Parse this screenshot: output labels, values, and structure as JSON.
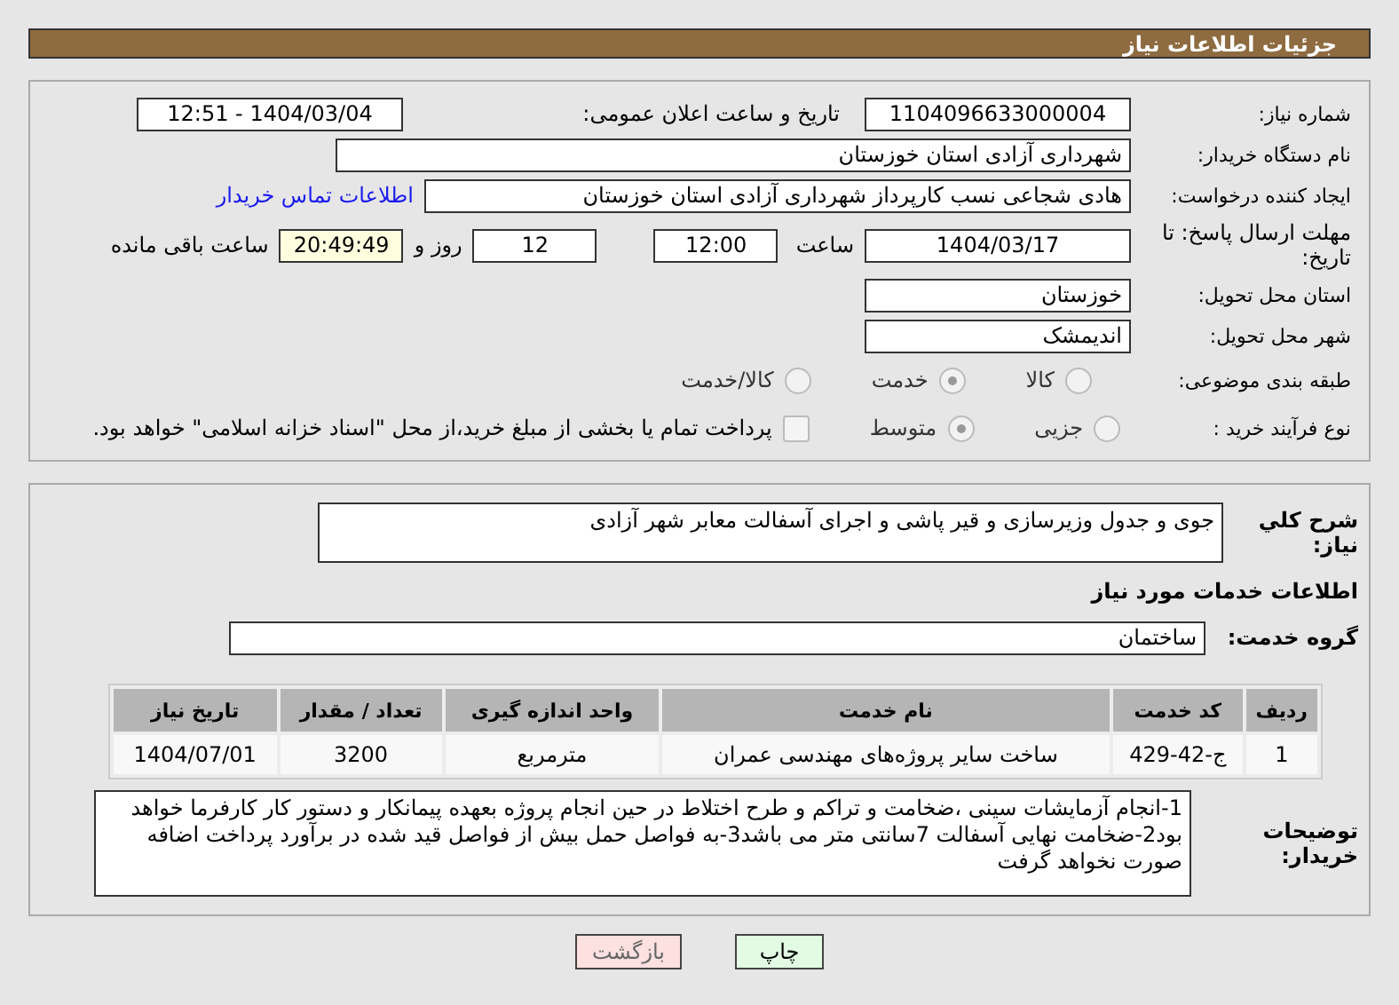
{
  "header": {
    "title": "جزئیات اطلاعات نیاز"
  },
  "need_number": {
    "label": "شماره نیاز:",
    "value": "1104096633000004"
  },
  "announce": {
    "label": "تاریخ و ساعت اعلان عمومی:",
    "value": "1404/03/04 - 12:51"
  },
  "buyer": {
    "label": "نام دستگاه خریدار:",
    "value": "شهرداری آزادی استان خوزستان"
  },
  "creator": {
    "label": "ایجاد کننده درخواست:",
    "value": "هادی شجاعی نسب کارپرداز شهرداری آزادی استان خوزستان",
    "link": "اطلاعات تماس خریدار"
  },
  "deadline": {
    "label": "مهلت ارسال پاسخ: تا تاریخ:",
    "date": "1404/03/17",
    "time_label": "ساعت",
    "time": "12:00",
    "days": "12",
    "days_label": "روز و",
    "remaining": "20:49:49",
    "remaining_label": "ساعت باقی مانده"
  },
  "province": {
    "label": "استان محل تحویل:",
    "value": "خوزستان"
  },
  "city": {
    "label": "شهر محل تحویل:",
    "value": "اندیمشک"
  },
  "category": {
    "label": "طبقه بندی موضوعی:",
    "options": [
      {
        "label": "کالا",
        "selected": false
      },
      {
        "label": "خدمت",
        "selected": true
      },
      {
        "label": "کالا/خدمت",
        "selected": false
      }
    ]
  },
  "process": {
    "label": "نوع فرآیند خرید :",
    "options": [
      {
        "label": "جزیی",
        "selected": false
      },
      {
        "label": "متوسط",
        "selected": true
      }
    ],
    "payment": {
      "checked": false,
      "text": "پرداخت تمام یا بخشی از مبلغ خرید،از محل \"اسناد خزانه اسلامی\" خواهد بود."
    }
  },
  "summary": {
    "label": "شرح کلي نياز:",
    "value": "جوی و جدول وزیرسازی و قیر پاشی و اجرای آسفالت معابر شهر آزادی"
  },
  "services_title": "اطلاعات خدمات مورد نیاز",
  "service_group": {
    "label": "گروه خدمت:",
    "value": "ساختمان"
  },
  "table": {
    "columns": [
      "ردیف",
      "کد خدمت",
      "نام خدمت",
      "واحد اندازه گیری",
      "تعداد / مقدار",
      "تاریخ نیاز"
    ],
    "rows": [
      [
        "1",
        "ج-42-429",
        "ساخت سایر پروژه‌های مهندسی عمران",
        "مترمربع",
        "3200",
        "1404/07/01"
      ]
    ]
  },
  "notes": {
    "label": "توضیحات خریدار:",
    "value": "1-انجام آزمایشات سینی ،ضخامت و تراکم و طرح اختلاط در حین انجام پروژه بعهده پیمانکار و دستور کار کارفرما خواهد بود2-ضخامت نهایی آسفالت 7سانتی متر می باشد3-به فواصل حمل بیش از فواصل قید شده در برآورد پرداخت اضافه صورت نخواهد گرفت"
  },
  "buttons": [
    {
      "label": "چاپ",
      "kind": "print"
    },
    {
      "label": "بازگشت",
      "kind": "back"
    }
  ]
}
